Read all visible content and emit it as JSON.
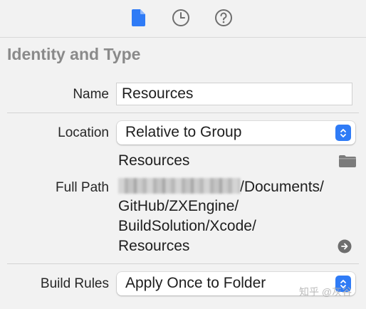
{
  "toolbar": {
    "tabs": [
      {
        "name": "file-inspector",
        "icon": "document-icon",
        "active": true
      },
      {
        "name": "history-inspector",
        "icon": "clock-icon",
        "active": false
      },
      {
        "name": "help-inspector",
        "icon": "help-icon",
        "active": false
      }
    ]
  },
  "section": {
    "title": "Identity and Type"
  },
  "name": {
    "label": "Name",
    "value": "Resources"
  },
  "location": {
    "label": "Location",
    "selected": "Relative to Group",
    "folder": "Resources"
  },
  "full_path": {
    "label": "Full Path",
    "line1_suffix": "/Documents/",
    "line2": "GitHub/ZXEngine/",
    "line3": "BuildSolution/Xcode/",
    "line4": "Resources"
  },
  "build_rules": {
    "label": "Build Rules",
    "selected": "Apply Once to Folder"
  },
  "watermark": "知乎 @灰谷",
  "colors": {
    "accent": "#2f7bf6",
    "background": "#f2f2f2",
    "section_title": "#8a8a8a"
  }
}
